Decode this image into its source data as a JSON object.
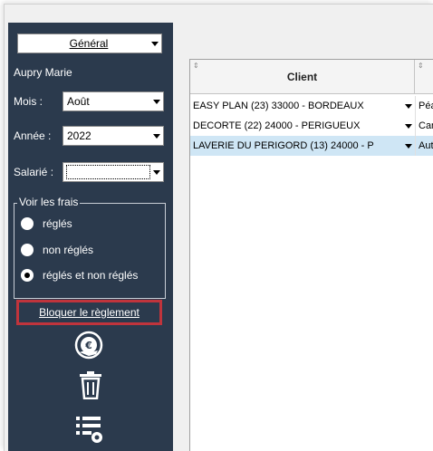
{
  "sidebar": {
    "general_select": "Général",
    "user_name": "Aupry Marie",
    "mois_label": "Mois :",
    "mois_value": "Août",
    "annee_label": "Année :",
    "annee_value": "2022",
    "salarie_label": "Salarié :",
    "salarie_value": "",
    "voir_frais_legend": "Voir les frais",
    "radio_options": [
      {
        "label": "réglés",
        "selected": false
      },
      {
        "label": "non réglés",
        "selected": false
      },
      {
        "label": "réglés et non réglés",
        "selected": true
      }
    ],
    "bloquer_link": "Bloquer le règlement",
    "icons": [
      "euro-hand-icon",
      "trash-icon",
      "list-settings-icon"
    ]
  },
  "grid": {
    "columns": [
      {
        "label": "Client",
        "sort_icon": "sort-icon"
      },
      {
        "label": "",
        "sort_icon": "sort-icon"
      }
    ],
    "rows": [
      {
        "client": "EASY PLAN (23) 33000 -  BORDEAUX",
        "second": "Péa",
        "selected": false
      },
      {
        "client": "DECORTE (22) 24000 -  PERIGUEUX",
        "second": "Carb",
        "selected": false
      },
      {
        "client": "LAVERIE DU PERIGORD (13) 24000 -  P",
        "second": "Auto",
        "selected": true
      }
    ]
  },
  "colors": {
    "sidebar_bg": "#2b3a4d",
    "highlight_border": "#c0343c",
    "selected_row": "#cfe6f5"
  }
}
